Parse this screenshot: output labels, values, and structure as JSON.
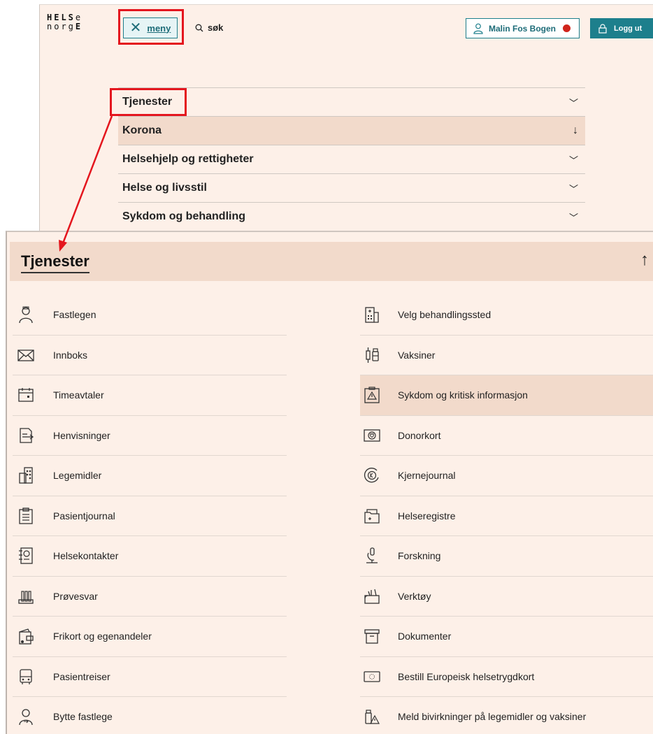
{
  "header": {
    "logo_line1": "HELSe",
    "logo_line2": "norgE",
    "menu_label": "meny",
    "search_label": "søk",
    "user_name": "Malin Fos Bogen",
    "logout_label": "Logg ut"
  },
  "nav": {
    "items": [
      {
        "label": "Tjenester"
      },
      {
        "label": "Korona"
      },
      {
        "label": "Helsehjelp og rettigheter"
      },
      {
        "label": "Helse og livsstil"
      },
      {
        "label": "Sykdom og behandling"
      }
    ]
  },
  "services": {
    "title": "Tjenester",
    "left": [
      {
        "label": "Fastlegen",
        "icon": "doctor-icon"
      },
      {
        "label": "Innboks",
        "icon": "envelope-icon"
      },
      {
        "label": "Timeavtaler",
        "icon": "calendar-icon"
      },
      {
        "label": "Henvisninger",
        "icon": "referral-icon"
      },
      {
        "label": "Legemidler",
        "icon": "pills-icon"
      },
      {
        "label": "Pasientjournal",
        "icon": "clipboard-icon"
      },
      {
        "label": "Helsekontakter",
        "icon": "contacts-icon"
      },
      {
        "label": "Prøvesvar",
        "icon": "test-tubes-icon"
      },
      {
        "label": "Frikort og egenandeler",
        "icon": "wallet-icon"
      },
      {
        "label": "Pasientreiser",
        "icon": "bus-icon"
      },
      {
        "label": "Bytte fastlege",
        "icon": "change-doctor-icon"
      }
    ],
    "right": [
      {
        "label": "Velg behandlingssted",
        "icon": "hospital-icon"
      },
      {
        "label": "Vaksiner",
        "icon": "vaccine-icon"
      },
      {
        "label": "Sykdom og kritisk informasjon",
        "icon": "warning-icon"
      },
      {
        "label": "Donorkort",
        "icon": "donor-card-icon"
      },
      {
        "label": "Kjernejournal",
        "icon": "core-journal-icon"
      },
      {
        "label": "Helseregistre",
        "icon": "folder-icon"
      },
      {
        "label": "Forskning",
        "icon": "microscope-icon"
      },
      {
        "label": "Verktøy",
        "icon": "tools-icon"
      },
      {
        "label": "Dokumenter",
        "icon": "archive-icon"
      },
      {
        "label": "Bestill Europeisk helsetrygdkort",
        "icon": "eu-card-icon"
      },
      {
        "label": "Meld bivirkninger på legemidler og vaksiner",
        "icon": "side-effects-icon"
      }
    ]
  },
  "colors": {
    "panel_bg": "#fdf0e8",
    "active_bg": "#f2dacb",
    "accent": "#1d7f8c",
    "highlight": "#e4161e"
  }
}
